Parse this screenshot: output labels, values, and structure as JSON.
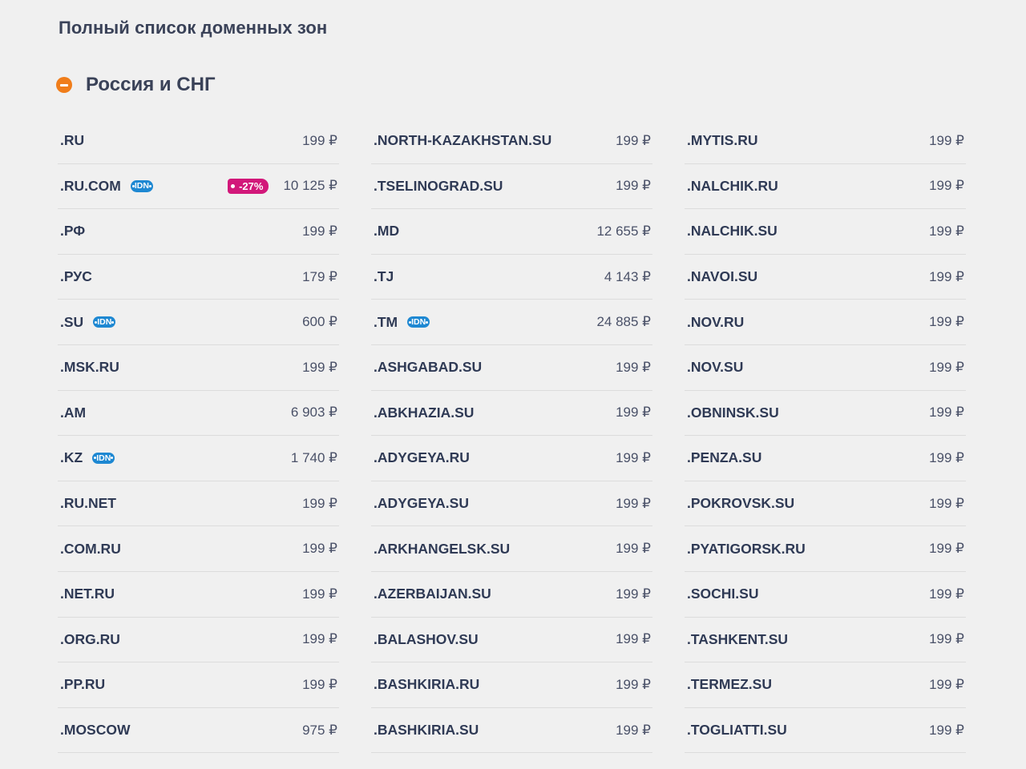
{
  "page": {
    "title": "Полный список доменных зон"
  },
  "section": {
    "title": "Россия и СНГ",
    "collapse_icon": "minus-circle-icon",
    "accent_color": "#f07d1a"
  },
  "badges": {
    "idn_label": "IDN",
    "idn_color": "#1e88d2",
    "discount_color": "#d2187a"
  },
  "columns": [
    [
      {
        "zone": ".RU",
        "price": "199 ₽"
      },
      {
        "zone": ".RU.COM",
        "idn": true,
        "discount": "-27%",
        "price": "10 125 ₽"
      },
      {
        "zone": ".РФ",
        "price": "199 ₽"
      },
      {
        "zone": ".РУС",
        "price": "179 ₽"
      },
      {
        "zone": ".SU",
        "idn": true,
        "price": "600 ₽"
      },
      {
        "zone": ".MSK.RU",
        "price": "199 ₽"
      },
      {
        "zone": ".AM",
        "price": "6 903 ₽"
      },
      {
        "zone": ".KZ",
        "idn": true,
        "price": "1 740 ₽"
      },
      {
        "zone": ".RU.NET",
        "price": "199 ₽"
      },
      {
        "zone": ".COM.RU",
        "price": "199 ₽"
      },
      {
        "zone": ".NET.RU",
        "price": "199 ₽"
      },
      {
        "zone": ".ORG.RU",
        "price": "199 ₽"
      },
      {
        "zone": ".PP.RU",
        "price": "199 ₽"
      },
      {
        "zone": ".MOSCOW",
        "price": "975 ₽"
      }
    ],
    [
      {
        "zone": ".NORTH-KAZAKHSTAN.SU",
        "price": "199 ₽"
      },
      {
        "zone": ".TSELINOGRAD.SU",
        "price": "199 ₽"
      },
      {
        "zone": ".MD",
        "price": "12 655 ₽"
      },
      {
        "zone": ".TJ",
        "price": "4 143 ₽"
      },
      {
        "zone": ".TM",
        "idn": true,
        "price": "24 885 ₽"
      },
      {
        "zone": ".ASHGABAD.SU",
        "price": "199 ₽"
      },
      {
        "zone": ".ABKHAZIA.SU",
        "price": "199 ₽"
      },
      {
        "zone": ".ADYGEYA.RU",
        "price": "199 ₽"
      },
      {
        "zone": ".ADYGEYA.SU",
        "price": "199 ₽"
      },
      {
        "zone": ".ARKHANGELSK.SU",
        "price": "199 ₽"
      },
      {
        "zone": ".AZERBAIJAN.SU",
        "price": "199 ₽"
      },
      {
        "zone": ".BALASHOV.SU",
        "price": "199 ₽"
      },
      {
        "zone": ".BASHKIRIA.RU",
        "price": "199 ₽"
      },
      {
        "zone": ".BASHKIRIA.SU",
        "price": "199 ₽"
      }
    ],
    [
      {
        "zone": ".MYTIS.RU",
        "price": "199 ₽"
      },
      {
        "zone": ".NALCHIK.RU",
        "price": "199 ₽"
      },
      {
        "zone": ".NALCHIK.SU",
        "price": "199 ₽"
      },
      {
        "zone": ".NAVOI.SU",
        "price": "199 ₽"
      },
      {
        "zone": ".NOV.RU",
        "price": "199 ₽"
      },
      {
        "zone": ".NOV.SU",
        "price": "199 ₽"
      },
      {
        "zone": ".OBNINSK.SU",
        "price": "199 ₽"
      },
      {
        "zone": ".PENZA.SU",
        "price": "199 ₽"
      },
      {
        "zone": ".POKROVSK.SU",
        "price": "199 ₽"
      },
      {
        "zone": ".PYATIGORSK.RU",
        "price": "199 ₽"
      },
      {
        "zone": ".SOCHI.SU",
        "price": "199 ₽"
      },
      {
        "zone": ".TASHKENT.SU",
        "price": "199 ₽"
      },
      {
        "zone": ".TERMEZ.SU",
        "price": "199 ₽"
      },
      {
        "zone": ".TOGLIATTI.SU",
        "price": "199 ₽"
      }
    ]
  ]
}
